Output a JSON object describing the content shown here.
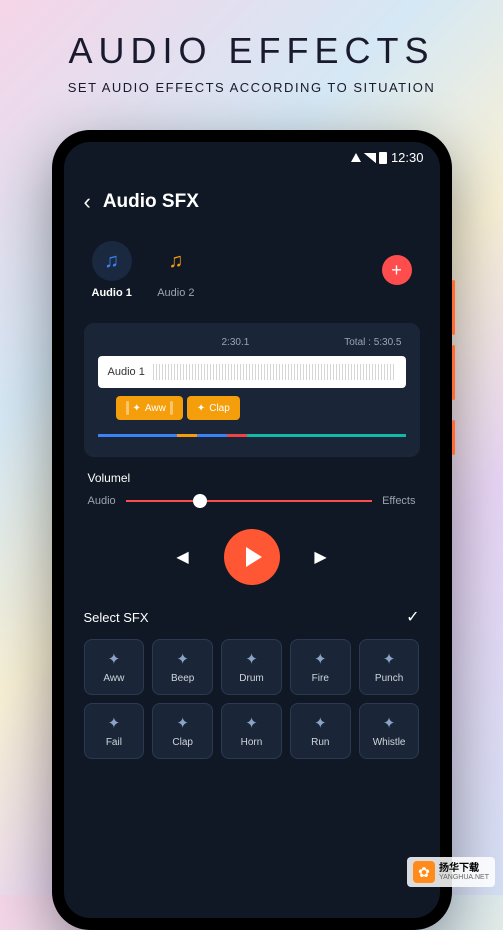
{
  "hero": {
    "title": "AUDIO EFFECTS",
    "subtitle": "SET AUDIO EFFECTS ACCORDING TO SITUATION"
  },
  "statusbar": {
    "time": "12:30"
  },
  "header": {
    "title": "Audio SFX"
  },
  "tabs": {
    "audio1": "Audio 1",
    "audio2": "Audio 2"
  },
  "timeline": {
    "current": "2:30.1",
    "total": "Total : 5:30.5",
    "track_label": "Audio 1",
    "clip1": "Aww",
    "clip2": "Clap"
  },
  "volume": {
    "title": "Volumel",
    "left": "Audio",
    "right": "Effects"
  },
  "sfx": {
    "title": "Select SFX",
    "items": [
      "Aww",
      "Beep",
      "Drum",
      "Fire",
      "Punch",
      "Fail",
      "Clap",
      "Horn",
      "Run",
      "Whistle"
    ]
  },
  "watermark": {
    "cn": "扬华下载",
    "url": "YANGHUA.NET"
  }
}
